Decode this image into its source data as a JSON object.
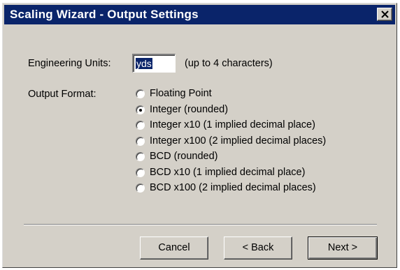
{
  "window": {
    "title": "Scaling Wizard - Output Settings",
    "close_label": "×"
  },
  "units": {
    "label": "Engineering Units:",
    "value": "yds",
    "hint": "(up to 4 characters)"
  },
  "output_format": {
    "label": "Output Format:",
    "selected_index": 1,
    "options": [
      "Floating Point",
      "Integer (rounded)",
      "Integer x10 (1 implied decimal place)",
      "Integer x100 (2 implied decimal places)",
      "BCD (rounded)",
      "BCD x10 (1 implied decimal place)",
      "BCD x100 (2 implied decimal places)"
    ]
  },
  "buttons": {
    "cancel": "Cancel",
    "back": "< Back",
    "next": "Next >"
  },
  "colors": {
    "titlebar": "#0a246a",
    "dialog_face": "#d4d0c8"
  }
}
